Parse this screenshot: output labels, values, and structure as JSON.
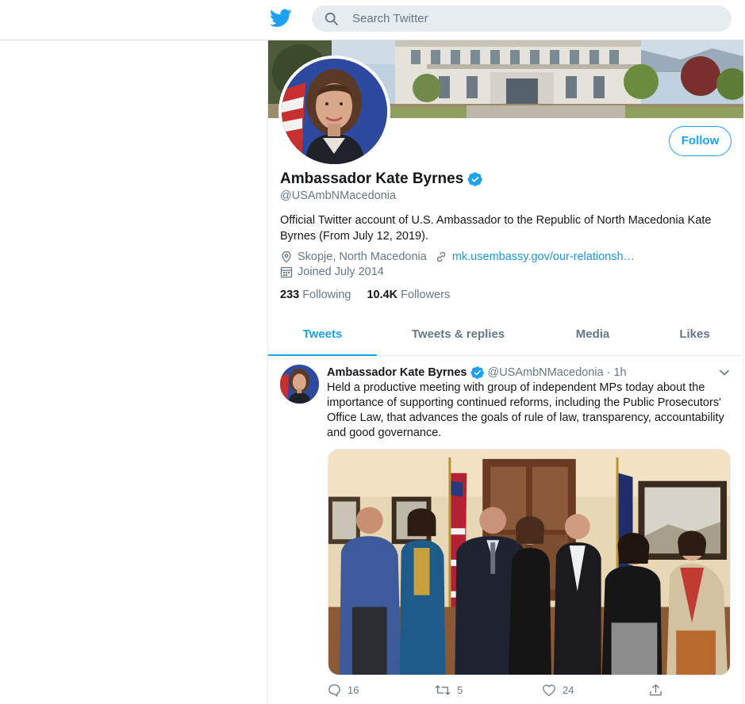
{
  "search": {
    "placeholder": "Search Twitter"
  },
  "profile": {
    "name": "Ambassador Kate Byrnes",
    "handle": "@USAmbNMacedonia",
    "bio": "Official Twitter account of U.S. Ambassador to the Republic of North Macedonia Kate Byrnes (From July 12, 2019).",
    "location": "Skopje, North Macedonia",
    "website": "mk.usembassy.gov/our-relationsh…",
    "joined": "Joined July 2014",
    "following_count": "233",
    "following_label": "Following",
    "followers_count": "10.4K",
    "followers_label": "Followers",
    "follow_button": "Follow"
  },
  "tabs": [
    {
      "label": "Tweets",
      "active": true
    },
    {
      "label": "Tweets & replies",
      "active": false
    },
    {
      "label": "Media",
      "active": false
    },
    {
      "label": "Likes",
      "active": false
    }
  ],
  "tweet": {
    "name": "Ambassador Kate Byrnes",
    "handle": "@USAmbNMacedonia · 1h",
    "text": "Held a productive meeting with group of independent MPs today about the importance of supporting continued reforms, including the Public Prosecutors' Office Law, that advances the goals of rule of law, transparency, accountability and good governance.",
    "replies": "16",
    "retweets": "5",
    "likes": "24"
  },
  "icons": {
    "logo": "twitter-bird-icon",
    "search": "search-icon",
    "verified": "verified-badge-icon",
    "location": "location-pin-icon",
    "link": "link-icon",
    "calendar": "calendar-icon",
    "reply": "reply-icon",
    "retweet": "retweet-icon",
    "like": "heart-icon",
    "share": "share-icon",
    "more": "chevron-down-icon"
  },
  "colors": {
    "accent": "#1da1f2",
    "text": "#14171a",
    "secondary": "#657786"
  }
}
